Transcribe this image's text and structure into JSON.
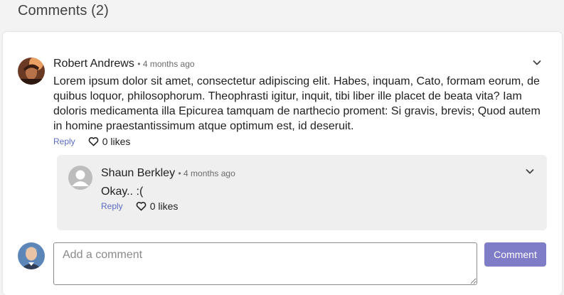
{
  "section": {
    "title": "Comments (2)"
  },
  "comments": [
    {
      "author": "Robert Andrews",
      "time": "• 4 months ago",
      "text": "Lorem ipsum dolor sit amet, consectetur adipiscing elit. Habes, inquam, Cato, formam eorum, de quibus loquor, philosophorum. Theophrasti igitur, inquit, tibi liber ille placet de beata vita? Iam doloris medicamenta illa Epicurea tamquam de narthecio proment: Si gravis, brevis; Quod autem in homine praestantissimum atque optimum est, id deseruit.",
      "reply_label": "Reply",
      "likes_label": "0 likes",
      "replies": [
        {
          "author": "Shaun Berkley",
          "time": "• 4 months ago",
          "text": "Okay.. :(",
          "reply_label": "Reply",
          "likes_label": "0 likes"
        }
      ]
    }
  ],
  "composer": {
    "placeholder": "Add a comment",
    "button_label": "Comment"
  },
  "colors": {
    "accent": "#7f7dc8",
    "link": "#5c6bc0",
    "reply_bg": "#efeff0"
  },
  "icons": [
    "chevron-down-icon",
    "heart-outline-icon",
    "user-placeholder-icon"
  ]
}
